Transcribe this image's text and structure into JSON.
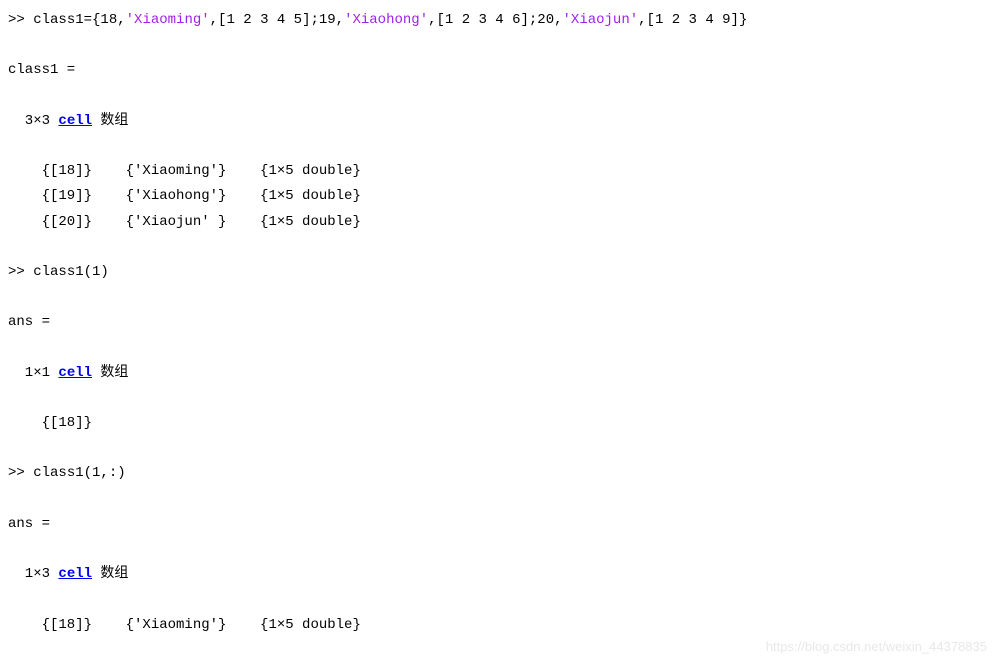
{
  "line1": {
    "prompt": ">> ",
    "cmd_part1": "class1={18,",
    "str1": "'Xiaoming'",
    "cmd_part2": ",[1 2 3 4 5];19,",
    "str2": "'Xiaohong'",
    "cmd_part3": ",[1 2 3 4 6];20,",
    "str3": "'Xiaojun'",
    "cmd_part4": ",[1 2 3 4 9]}"
  },
  "out1": {
    "header": "class1 =",
    "dims_pre": "  3×3 ",
    "link": "cell",
    "dims_post": " 数组",
    "row1": "    {[18]}    {'Xiaoming'}    {1×5 double}",
    "row2": "    {[19]}    {'Xiaohong'}    {1×5 double}",
    "row3": "    {[20]}    {'Xiaojun' }    {1×5 double}"
  },
  "line2": {
    "prompt": ">> ",
    "cmd": "class1(1)"
  },
  "out2": {
    "header": "ans =",
    "dims_pre": "  1×1 ",
    "link": "cell",
    "dims_post": " 数组",
    "row1": "    {[18]}"
  },
  "line3": {
    "prompt": ">> ",
    "cmd": "class1(1,:)"
  },
  "out3": {
    "header": "ans =",
    "dims_pre": "  1×3 ",
    "link": "cell",
    "dims_post": " 数组",
    "row1": "    {[18]}    {'Xiaoming'}    {1×5 double}"
  },
  "watermark": "https://blog.csdn.net/weixin_44378835"
}
